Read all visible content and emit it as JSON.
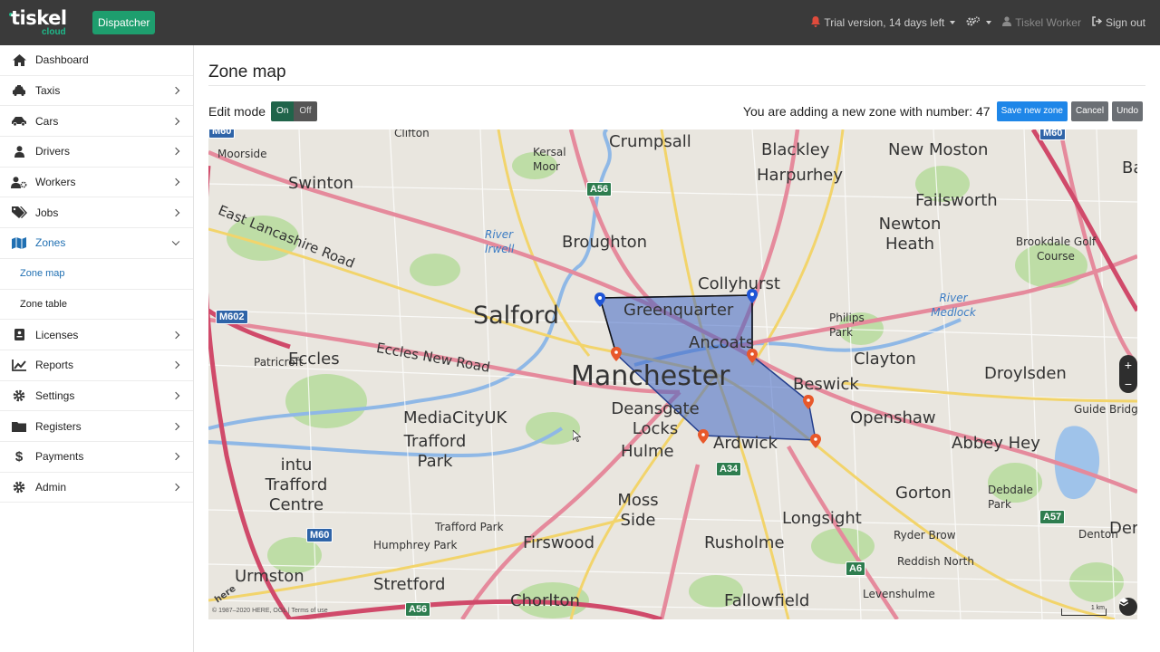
{
  "header": {
    "logo_text": "tiskel",
    "logo_sub": "cloud",
    "dispatcher_label": "Dispatcher",
    "trial_text": "Trial version, 14 days left",
    "user_name": "Tiskel Worker",
    "sign_out": "Sign out"
  },
  "sidebar": {
    "items": [
      {
        "label": "Dashboard",
        "icon": "home-icon"
      },
      {
        "label": "Taxis",
        "icon": "taxi-icon"
      },
      {
        "label": "Cars",
        "icon": "car-icon"
      },
      {
        "label": "Drivers",
        "icon": "user-icon"
      },
      {
        "label": "Workers",
        "icon": "users-gear-icon"
      },
      {
        "label": "Jobs",
        "icon": "tags-icon"
      },
      {
        "label": "Zones",
        "icon": "map-icon"
      },
      {
        "label": "Licenses",
        "icon": "license-icon"
      },
      {
        "label": "Reports",
        "icon": "chart-line-icon"
      },
      {
        "label": "Settings",
        "icon": "gear-icon"
      },
      {
        "label": "Registers",
        "icon": "folder-icon"
      },
      {
        "label": "Payments",
        "icon": "dollar-icon"
      },
      {
        "label": "Admin",
        "icon": "gear-icon"
      }
    ],
    "zone_sub": [
      "Zone map",
      "Zone table"
    ]
  },
  "main": {
    "title": "Zone map",
    "edit_mode_label": "Edit mode",
    "toggle_on": "On",
    "toggle_off": "Off",
    "zone_message": "You are adding a new zone with number: 47",
    "save_label": "Save new zone",
    "cancel_label": "Cancel",
    "undo_label": "Undo"
  },
  "map": {
    "labels": {
      "clifton": "Clifton",
      "crumpsall": "Crumpsall",
      "blackley": "Blackley",
      "harpurhey": "Harpurhey",
      "new_moston": "New Moston",
      "moston": "Moston",
      "moorside": "Moorside",
      "kersal_moor": "Kersal Moor",
      "swinton": "Swinton",
      "east_lancs": "East Lancashire Road",
      "failsworth": "Failsworth",
      "newton_heath": "Newton Heath",
      "brookdale": "Brookdale Golf Course",
      "river_irwell": "River Irwell",
      "broughton": "Broughton",
      "collyhurst": "Collyhurst",
      "salford": "Salford",
      "greenquarter": "Greenquarter",
      "ancoats": "Ancoats",
      "philips_park": "Philips Park",
      "river_medlock": "River Medlock",
      "patricroft": "Patricroft",
      "eccles": "Eccles",
      "eccles_new_road": "Eccles New Road",
      "manchester": "Manchester",
      "clayton": "Clayton",
      "droylsden": "Droylsden",
      "beswick": "Beswick",
      "guide_bridge": "Guide Bridge",
      "mediacity": "MediaCityUK",
      "deansgate": "Deansgate Locks",
      "openshaw": "Openshaw",
      "trafford_park": "Trafford Park",
      "hulme": "Hulme",
      "ardwick": "Ardwick",
      "abbey_hey": "Abbey Hey",
      "intu": "intu Trafford Centre",
      "trafford_park_st": "Trafford Park",
      "moss_side": "Moss Side",
      "gorton": "Gorton",
      "debdale": "Debdale Park",
      "longsight": "Longsight",
      "humphrey": "Humphrey Park",
      "firswood": "Firswood",
      "rusholme": "Rusholme",
      "ryder_brow": "Ryder Brow",
      "denton": "Denton",
      "urmston": "Urmston",
      "stretford": "Stretford",
      "chorlton": "Chorlton",
      "fallowfield": "Fallowfield",
      "reddish_north": "Reddish North",
      "levenshulme": "Levenshulme",
      "ba": "Ba",
      "der": "Der"
    },
    "shields": {
      "m60a": "M60",
      "m60b": "M60",
      "m60c": "M60",
      "m602": "M602",
      "a56a": "A56",
      "a56b": "A56",
      "a34": "A34",
      "a57": "A57",
      "a6": "A6"
    },
    "copyright": "© 1987–2020 HERE, OGL | Terms of use",
    "scale_label": "1 km",
    "zoom_in": "+",
    "zoom_out": "−",
    "here_logo": "here"
  }
}
